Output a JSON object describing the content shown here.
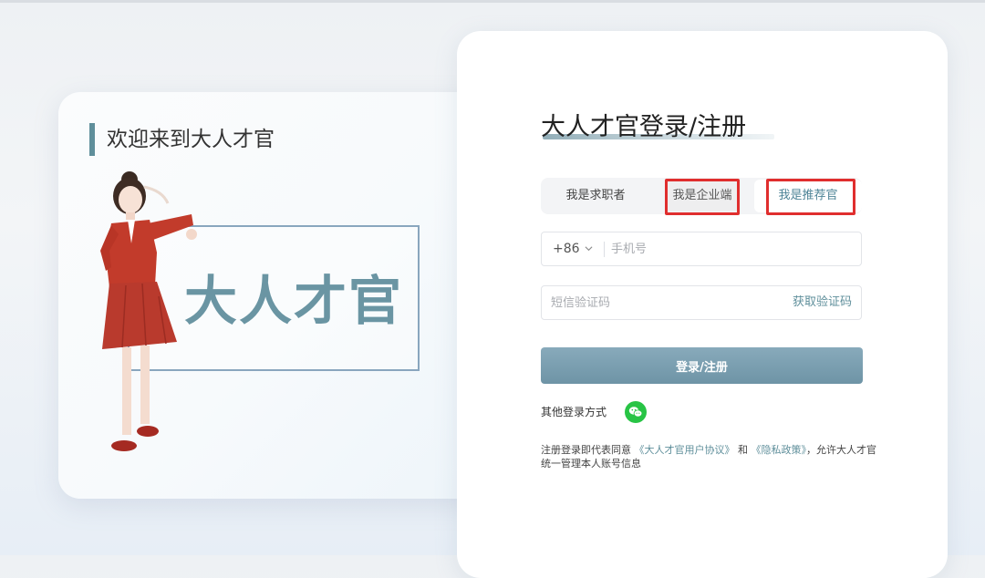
{
  "welcome": {
    "title": "欢迎来到大人才官",
    "brand_logo": "大人才官"
  },
  "login": {
    "title": "大人才官登录/注册",
    "tabs": [
      {
        "label": "我是求职者"
      },
      {
        "label": "我是企业端"
      },
      {
        "label": "我是推荐官"
      }
    ],
    "phone": {
      "country_code": "+86",
      "placeholder": "手机号"
    },
    "sms": {
      "placeholder": "短信验证码",
      "get_code_label": "获取验证码"
    },
    "submit_label": "登录/注册",
    "other_login_label": "其他登录方式",
    "agreement": {
      "prefix": "注册登录即代表同意",
      "user_agreement": "《大人才官用户协议》",
      "and": "和",
      "privacy": "《隐私政策》",
      "suffix": "，允许大人才官统一管理本人账号信息"
    }
  },
  "colors": {
    "accent": "#5f8f9b",
    "highlight": "#e02e2e",
    "wechat": "#28c445"
  }
}
